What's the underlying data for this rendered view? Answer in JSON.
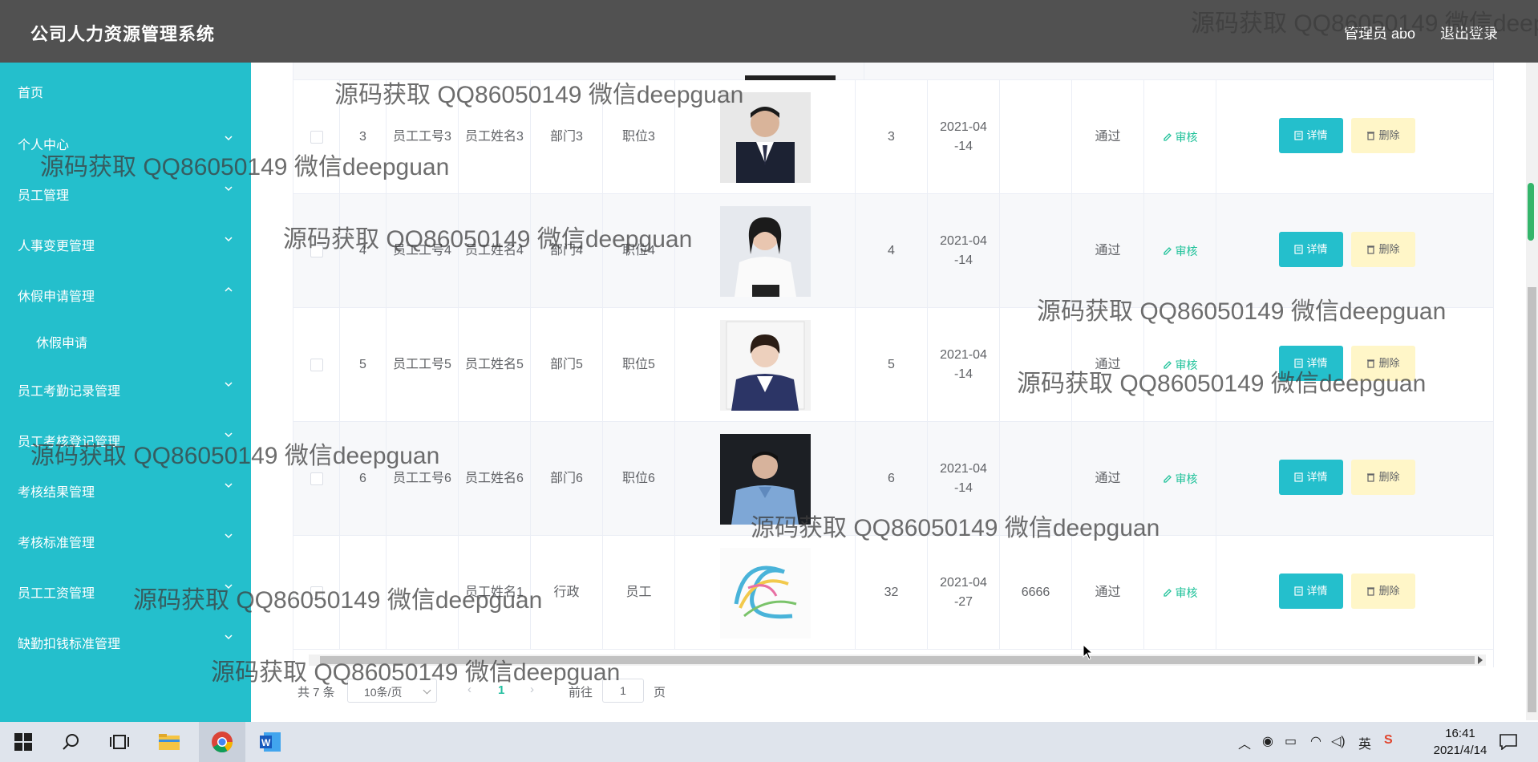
{
  "header": {
    "title": "公司人力资源管理系统",
    "admin_label": "管理员 abo",
    "logout_label": "退出登录"
  },
  "sidebar": {
    "items": [
      {
        "label": "首页",
        "expandable": false
      },
      {
        "label": "个人中心",
        "expandable": true
      },
      {
        "label": "员工管理",
        "expandable": true
      },
      {
        "label": "人事变更管理",
        "expandable": true
      },
      {
        "label": "休假申请管理",
        "expandable": true,
        "expanded": true
      },
      {
        "label": "休假申请",
        "sub": true
      },
      {
        "label": "员工考勤记录管理",
        "expandable": true
      },
      {
        "label": "员工考核登记管理",
        "expandable": true
      },
      {
        "label": "考核结果管理",
        "expandable": true
      },
      {
        "label": "考核标准管理",
        "expandable": true
      },
      {
        "label": "员工工资管理",
        "expandable": true
      },
      {
        "label": "缺勤扣钱标准管理",
        "expandable": true
      }
    ]
  },
  "table": {
    "rows": [
      {
        "index": "3",
        "emp_no": "员工工号3",
        "emp_name": "员工姓名3",
        "dept": "部门3",
        "position": "职位3",
        "days": "3",
        "date": "2021-04-14",
        "reason": "",
        "status": "通过",
        "audit": "审核",
        "detail": "详情",
        "delete": "删除",
        "photo": "man-suit"
      },
      {
        "index": "4",
        "emp_no": "员工工号4",
        "emp_name": "员工姓名4",
        "dept": "部门4",
        "position": "职位4",
        "days": "4",
        "date": "2021-04-14",
        "reason": "",
        "status": "通过",
        "audit": "审核",
        "detail": "详情",
        "delete": "删除",
        "photo": "woman-white"
      },
      {
        "index": "5",
        "emp_no": "员工工号5",
        "emp_name": "员工姓名5",
        "dept": "部门5",
        "position": "职位5",
        "days": "5",
        "date": "2021-04-14",
        "reason": "",
        "status": "通过",
        "audit": "审核",
        "detail": "详情",
        "delete": "删除",
        "photo": "woman-blazer"
      },
      {
        "index": "6",
        "emp_no": "员工工号6",
        "emp_name": "员工姓名6",
        "dept": "部门6",
        "position": "职位6",
        "days": "6",
        "date": "2021-04-14",
        "reason": "",
        "status": "通过",
        "audit": "审核",
        "detail": "详情",
        "delete": "删除",
        "photo": "man-shirt"
      },
      {
        "index": "",
        "emp_no": "",
        "emp_name": "员工姓名1",
        "dept": "行政",
        "position": "员工",
        "days": "32",
        "date": "2021-04-27",
        "reason": "6666",
        "status": "通过",
        "audit": "审核",
        "detail": "详情",
        "delete": "删除",
        "photo": "abstract"
      }
    ]
  },
  "pagination": {
    "total": "共 7 条",
    "page_size": "10条/页",
    "current": "1",
    "goto_label": "前往",
    "goto_value": "1",
    "page_unit": "页"
  },
  "watermark": "源码获取 QQ86050149 微信deepguan",
  "taskbar": {
    "time": "16:41",
    "date": "2021/4/14",
    "ime": "英"
  },
  "colors": {
    "sidebar": "#24bfcc",
    "header": "#515151",
    "detail_button": "#24bfcc",
    "delete_button": "#fff6c8",
    "audit_text": "#20c29a"
  }
}
